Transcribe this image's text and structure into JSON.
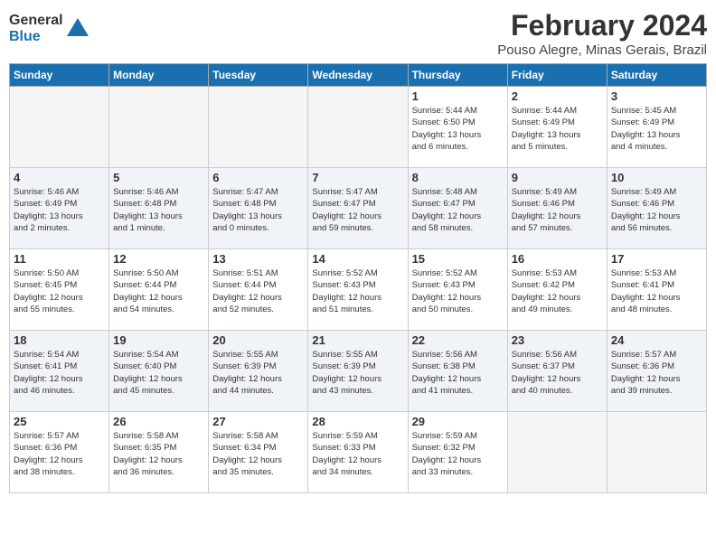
{
  "logo": {
    "general": "General",
    "blue": "Blue"
  },
  "title": {
    "month_year": "February 2024",
    "location": "Pouso Alegre, Minas Gerais, Brazil"
  },
  "calendar": {
    "headers": [
      "Sunday",
      "Monday",
      "Tuesday",
      "Wednesday",
      "Thursday",
      "Friday",
      "Saturday"
    ],
    "weeks": [
      [
        {
          "day": "",
          "info": "",
          "empty": true
        },
        {
          "day": "",
          "info": "",
          "empty": true
        },
        {
          "day": "",
          "info": "",
          "empty": true
        },
        {
          "day": "",
          "info": "",
          "empty": true
        },
        {
          "day": "1",
          "info": "Sunrise: 5:44 AM\nSunset: 6:50 PM\nDaylight: 13 hours\nand 6 minutes."
        },
        {
          "day": "2",
          "info": "Sunrise: 5:44 AM\nSunset: 6:49 PM\nDaylight: 13 hours\nand 5 minutes."
        },
        {
          "day": "3",
          "info": "Sunrise: 5:45 AM\nSunset: 6:49 PM\nDaylight: 13 hours\nand 4 minutes."
        }
      ],
      [
        {
          "day": "4",
          "info": "Sunrise: 5:46 AM\nSunset: 6:49 PM\nDaylight: 13 hours\nand 2 minutes."
        },
        {
          "day": "5",
          "info": "Sunrise: 5:46 AM\nSunset: 6:48 PM\nDaylight: 13 hours\nand 1 minute."
        },
        {
          "day": "6",
          "info": "Sunrise: 5:47 AM\nSunset: 6:48 PM\nDaylight: 13 hours\nand 0 minutes."
        },
        {
          "day": "7",
          "info": "Sunrise: 5:47 AM\nSunset: 6:47 PM\nDaylight: 12 hours\nand 59 minutes."
        },
        {
          "day": "8",
          "info": "Sunrise: 5:48 AM\nSunset: 6:47 PM\nDaylight: 12 hours\nand 58 minutes."
        },
        {
          "day": "9",
          "info": "Sunrise: 5:49 AM\nSunset: 6:46 PM\nDaylight: 12 hours\nand 57 minutes."
        },
        {
          "day": "10",
          "info": "Sunrise: 5:49 AM\nSunset: 6:46 PM\nDaylight: 12 hours\nand 56 minutes."
        }
      ],
      [
        {
          "day": "11",
          "info": "Sunrise: 5:50 AM\nSunset: 6:45 PM\nDaylight: 12 hours\nand 55 minutes."
        },
        {
          "day": "12",
          "info": "Sunrise: 5:50 AM\nSunset: 6:44 PM\nDaylight: 12 hours\nand 54 minutes."
        },
        {
          "day": "13",
          "info": "Sunrise: 5:51 AM\nSunset: 6:44 PM\nDaylight: 12 hours\nand 52 minutes."
        },
        {
          "day": "14",
          "info": "Sunrise: 5:52 AM\nSunset: 6:43 PM\nDaylight: 12 hours\nand 51 minutes."
        },
        {
          "day": "15",
          "info": "Sunrise: 5:52 AM\nSunset: 6:43 PM\nDaylight: 12 hours\nand 50 minutes."
        },
        {
          "day": "16",
          "info": "Sunrise: 5:53 AM\nSunset: 6:42 PM\nDaylight: 12 hours\nand 49 minutes."
        },
        {
          "day": "17",
          "info": "Sunrise: 5:53 AM\nSunset: 6:41 PM\nDaylight: 12 hours\nand 48 minutes."
        }
      ],
      [
        {
          "day": "18",
          "info": "Sunrise: 5:54 AM\nSunset: 6:41 PM\nDaylight: 12 hours\nand 46 minutes."
        },
        {
          "day": "19",
          "info": "Sunrise: 5:54 AM\nSunset: 6:40 PM\nDaylight: 12 hours\nand 45 minutes."
        },
        {
          "day": "20",
          "info": "Sunrise: 5:55 AM\nSunset: 6:39 PM\nDaylight: 12 hours\nand 44 minutes."
        },
        {
          "day": "21",
          "info": "Sunrise: 5:55 AM\nSunset: 6:39 PM\nDaylight: 12 hours\nand 43 minutes."
        },
        {
          "day": "22",
          "info": "Sunrise: 5:56 AM\nSunset: 6:38 PM\nDaylight: 12 hours\nand 41 minutes."
        },
        {
          "day": "23",
          "info": "Sunrise: 5:56 AM\nSunset: 6:37 PM\nDaylight: 12 hours\nand 40 minutes."
        },
        {
          "day": "24",
          "info": "Sunrise: 5:57 AM\nSunset: 6:36 PM\nDaylight: 12 hours\nand 39 minutes."
        }
      ],
      [
        {
          "day": "25",
          "info": "Sunrise: 5:57 AM\nSunset: 6:36 PM\nDaylight: 12 hours\nand 38 minutes."
        },
        {
          "day": "26",
          "info": "Sunrise: 5:58 AM\nSunset: 6:35 PM\nDaylight: 12 hours\nand 36 minutes."
        },
        {
          "day": "27",
          "info": "Sunrise: 5:58 AM\nSunset: 6:34 PM\nDaylight: 12 hours\nand 35 minutes."
        },
        {
          "day": "28",
          "info": "Sunrise: 5:59 AM\nSunset: 6:33 PM\nDaylight: 12 hours\nand 34 minutes."
        },
        {
          "day": "29",
          "info": "Sunrise: 5:59 AM\nSunset: 6:32 PM\nDaylight: 12 hours\nand 33 minutes."
        },
        {
          "day": "",
          "info": "",
          "empty": true
        },
        {
          "day": "",
          "info": "",
          "empty": true
        }
      ]
    ]
  }
}
